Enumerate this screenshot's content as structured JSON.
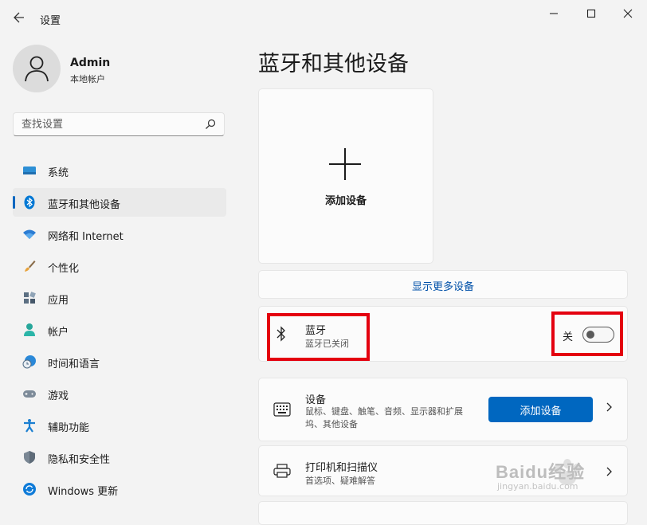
{
  "window": {
    "title": "设置"
  },
  "user": {
    "name": "Admin",
    "account_type": "本地帐户"
  },
  "search": {
    "placeholder": "查找设置"
  },
  "sidebar": {
    "items": [
      {
        "label": "系统",
        "icon": "monitor-icon",
        "active": false
      },
      {
        "label": "蓝牙和其他设备",
        "icon": "bluetooth-icon",
        "active": true
      },
      {
        "label": "网络和 Internet",
        "icon": "wifi-icon",
        "active": false
      },
      {
        "label": "个性化",
        "icon": "brush-icon",
        "active": false
      },
      {
        "label": "应用",
        "icon": "apps-icon",
        "active": false
      },
      {
        "label": "帐户",
        "icon": "person-icon",
        "active": false
      },
      {
        "label": "时间和语言",
        "icon": "clock-globe-icon",
        "active": false
      },
      {
        "label": "游戏",
        "icon": "gamepad-icon",
        "active": false
      },
      {
        "label": "辅助功能",
        "icon": "accessibility-icon",
        "active": false
      },
      {
        "label": "隐私和安全性",
        "icon": "shield-icon",
        "active": false
      },
      {
        "label": "Windows 更新",
        "icon": "update-icon",
        "active": false
      }
    ]
  },
  "main": {
    "title": "蓝牙和其他设备",
    "add_tile_label": "添加设备",
    "show_more": "显示更多设备",
    "bluetooth": {
      "title": "蓝牙",
      "subtitle": "蓝牙已关闭",
      "toggle_label": "关",
      "on": false
    },
    "devices": {
      "title": "设备",
      "subtitle": "鼠标、键盘、触笔、音频、显示器和扩展坞、其他设备",
      "button": "添加设备"
    },
    "printers": {
      "title": "打印机和扫描仪",
      "subtitle": "首选项、疑难解答"
    }
  },
  "watermark": {
    "text": "Baidu经验",
    "url": "jingyan.baidu.com"
  },
  "colors": {
    "accent": "#0067c0",
    "highlight": "#e4000f",
    "background": "#f3f3f3"
  }
}
